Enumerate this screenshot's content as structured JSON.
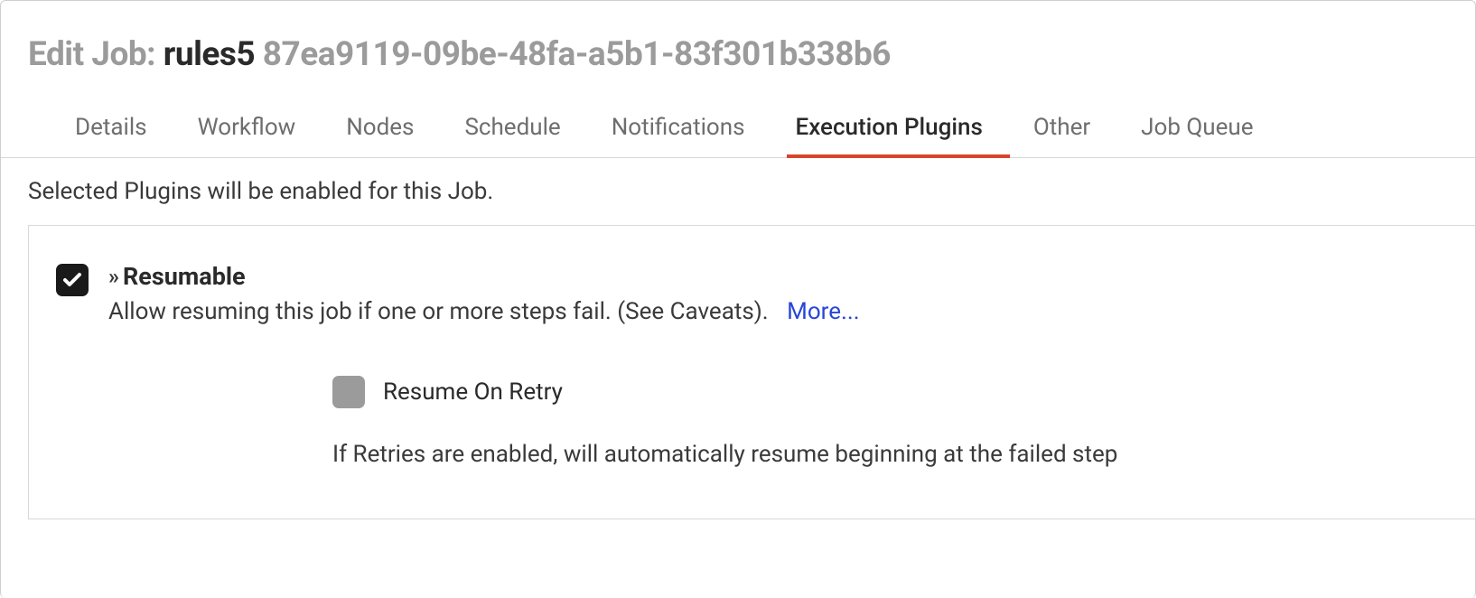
{
  "header": {
    "prefix": "Edit Job: ",
    "job_name": "rules5",
    "job_uuid": " 87ea9119-09be-48fa-a5b1-83f301b338b6"
  },
  "tabs": {
    "details": "Details",
    "workflow": "Workflow",
    "nodes": "Nodes",
    "schedule": "Schedule",
    "notifications": "Notifications",
    "execution_plugins": "Execution Plugins",
    "other": "Other",
    "job_queue": "Job Queue",
    "active": "execution_plugins"
  },
  "subtitle": "Selected Plugins will be enabled for this Job.",
  "plugin": {
    "title": "Resumable",
    "description": "Allow resuming this job if one or more steps fail. (See Caveats).",
    "more_label": "More...",
    "checked": true,
    "sub_option": {
      "label": "Resume On Retry",
      "description": "If Retries are enabled, will automatically resume beginning at the failed step",
      "checked": false
    }
  }
}
